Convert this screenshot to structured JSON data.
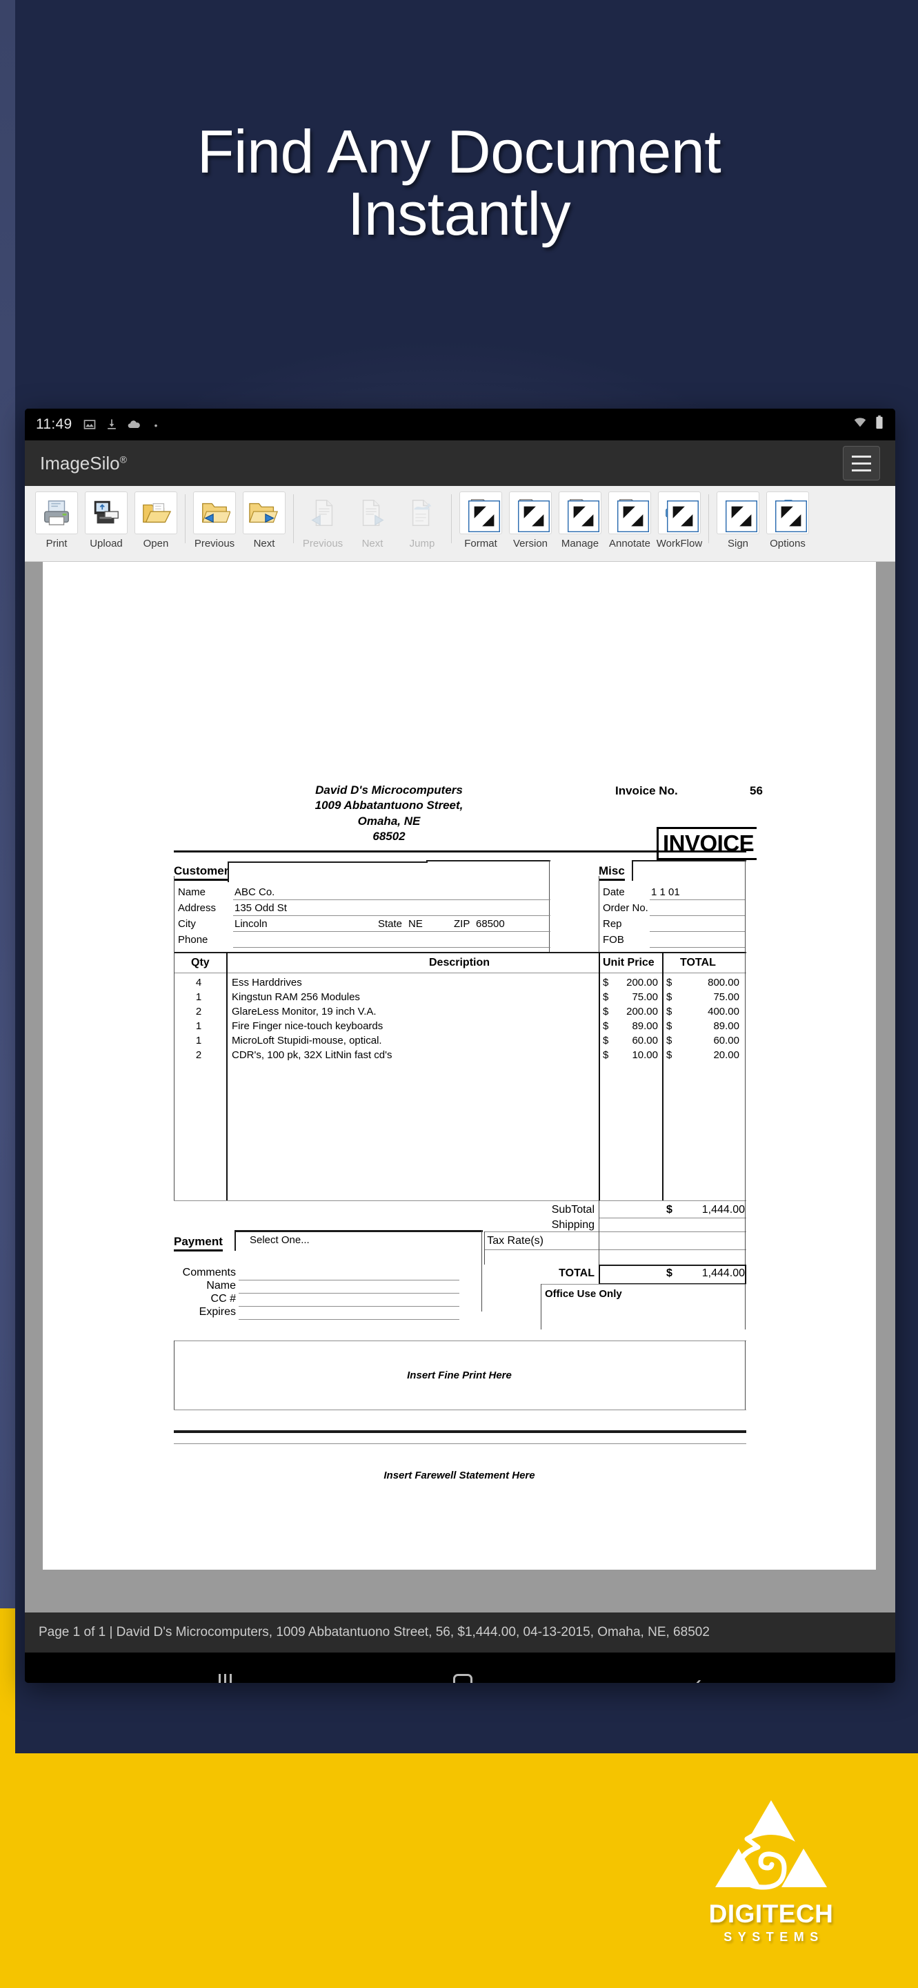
{
  "headline": {
    "line1": "Find Any Document",
    "line2": "Instantly"
  },
  "status_bar": {
    "clock": "11:49",
    "icons": [
      "image-icon",
      "download-icon",
      "cloud-icon",
      "dot-icon"
    ],
    "right_icons": [
      "wifi-icon",
      "battery-icon"
    ]
  },
  "app_bar": {
    "title": "ImageSilo",
    "registered_mark": "®",
    "menu": "menu-button"
  },
  "toolbar": {
    "items": [
      {
        "label": "Print",
        "icon": "printer-icon",
        "enabled": true,
        "group": 0
      },
      {
        "label": "Upload",
        "icon": "upload-monitor-icon",
        "enabled": true,
        "group": 0
      },
      {
        "label": "Open",
        "icon": "open-folder-icon",
        "enabled": true,
        "group": 0
      },
      {
        "label": "Previous",
        "icon": "folder-prev-icon",
        "enabled": true,
        "group": 1
      },
      {
        "label": "Next",
        "icon": "folder-next-icon",
        "enabled": true,
        "group": 1
      },
      {
        "label": "Previous",
        "icon": "page-prev-icon",
        "enabled": false,
        "group": 2
      },
      {
        "label": "Next",
        "icon": "page-next-icon",
        "enabled": false,
        "group": 2
      },
      {
        "label": "Jump",
        "icon": "page-jump-icon",
        "enabled": false,
        "group": 2
      },
      {
        "label": "Format",
        "icon": "page-wrench-icon",
        "enabled": true,
        "group": 3
      },
      {
        "label": "Version",
        "icon": "page-lock-icon",
        "enabled": true,
        "group": 3
      },
      {
        "label": "Manage",
        "icon": "page-gear-icon",
        "enabled": true,
        "group": 3
      },
      {
        "label": "Annotate",
        "icon": "page-note-icon",
        "enabled": true,
        "group": 3
      },
      {
        "label": "WorkFlow",
        "icon": "workflow-icon",
        "enabled": true,
        "group": 3
      },
      {
        "label": "Sign",
        "icon": "pencil-icon",
        "enabled": true,
        "group": 4
      },
      {
        "label": "Options",
        "icon": "clipboard-check-icon",
        "enabled": true,
        "group": 4
      }
    ]
  },
  "document": {
    "from": {
      "name": "David D's Microcomputers",
      "street": "1009 Abbatantuono Street,",
      "city_state": "Omaha, NE",
      "zip": "68502"
    },
    "invoice_no_label": "Invoice No.",
    "invoice_no_value": "56",
    "title": "INVOICE",
    "customer": {
      "section": "Customer",
      "fields": [
        {
          "label": "Name",
          "value": "ABC Co."
        },
        {
          "label": "Address",
          "value": "135 Odd St"
        },
        {
          "label": "City",
          "value": "Lincoln"
        },
        {
          "label": "Phone",
          "value": ""
        }
      ],
      "state_label": "State",
      "state_value": "NE",
      "zip_label": "ZIP",
      "zip_value": "68500"
    },
    "misc": {
      "section": "Misc",
      "fields": [
        {
          "label": "Date",
          "value": "1 1 01"
        },
        {
          "label": "Order No.",
          "value": ""
        },
        {
          "label": "Rep",
          "value": ""
        },
        {
          "label": "FOB",
          "value": ""
        }
      ]
    },
    "items_table": {
      "headers": [
        "Qty",
        "Description",
        "Unit Price",
        "TOTAL"
      ],
      "rows": [
        {
          "qty": "4",
          "desc": "Ess Harddrives",
          "unit": "200.00",
          "total": "800.00"
        },
        {
          "qty": "1",
          "desc": "Kingstun RAM 256 Modules",
          "unit": "75.00",
          "total": "75.00"
        },
        {
          "qty": "2",
          "desc": "GlareLess Monitor, 19 inch V.A.",
          "unit": "200.00",
          "total": "400.00"
        },
        {
          "qty": "1",
          "desc": "Fire Finger nice-touch keyboards",
          "unit": "89.00",
          "total": "89.00"
        },
        {
          "qty": "1",
          "desc": "MicroLoft Stupidi-mouse, optical.",
          "unit": "60.00",
          "total": "60.00"
        },
        {
          "qty": "2",
          "desc": "CDR's, 100 pk, 32X LitNin fast cd's",
          "unit": "10.00",
          "total": "20.00"
        }
      ],
      "currency": "$"
    },
    "totals": {
      "subtotal_label": "SubTotal",
      "subtotal_value": "1,444.00",
      "shipping_label": "Shipping",
      "shipping_value": "",
      "tax_label": "Tax Rate(s)",
      "total_label": "TOTAL",
      "total_value": "1,444.00"
    },
    "payment": {
      "section": "Payment",
      "select_value": "Select One...",
      "fields": [
        {
          "label": "Comments",
          "value": ""
        },
        {
          "label": "Name",
          "value": ""
        },
        {
          "label": "CC #",
          "value": ""
        },
        {
          "label": "Expires",
          "value": ""
        }
      ]
    },
    "office_use_only": "Office Use Only",
    "fine_print": "Insert Fine Print Here",
    "farewell": "Insert Farewell Statement Here"
  },
  "doc_footer": {
    "text": "Page 1 of 1 | David D's Microcomputers, 1009 Abbatantuono Street, 56, $1,444.00, 04-13-2015, Omaha, NE, 68502"
  },
  "nav_bar": {
    "recent": "recents-button",
    "home": "home-button",
    "back": "back-button"
  },
  "logo": {
    "name": "DIGITECH",
    "sub": "SYSTEMS",
    "mark": "digitech-triangle-icon"
  },
  "colors": {
    "brand_yellow": "#f5c400",
    "background_navy": "#1e2746",
    "toolbar_bg": "#efefef",
    "appbar_bg": "#2d2d2d"
  }
}
